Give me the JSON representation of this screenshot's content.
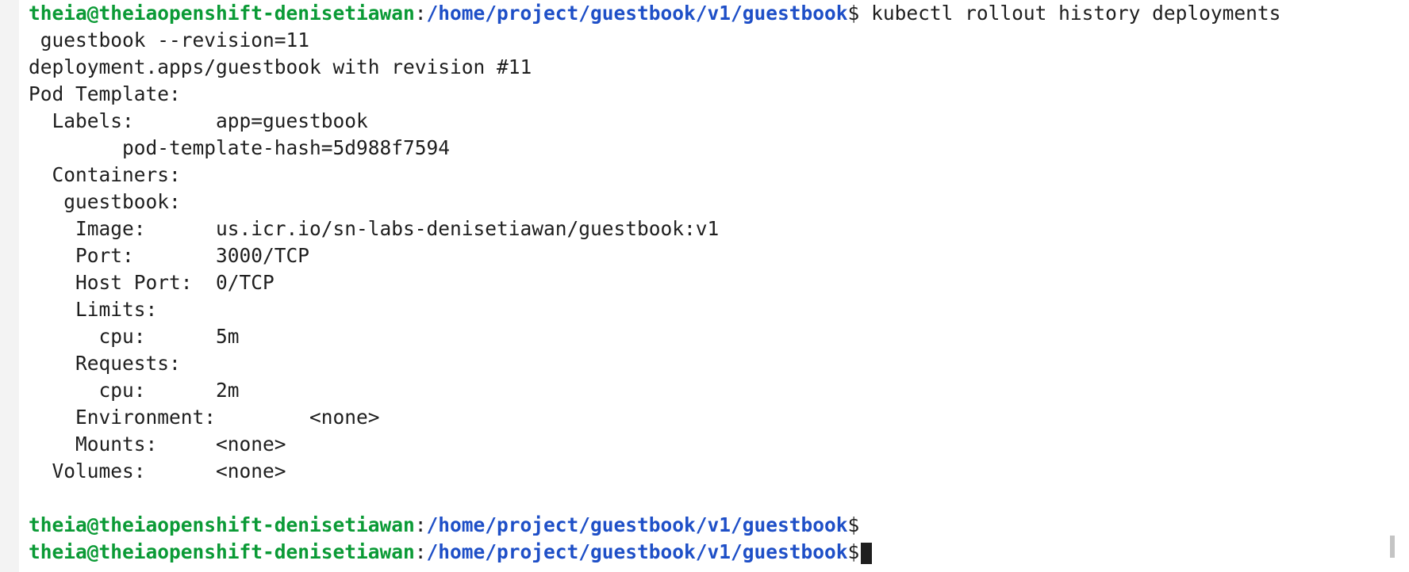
{
  "prompt": {
    "user_host": "theia@theiaopenshift-denisetiawan",
    "colon": ":",
    "path": "/home/project/guestbook/v1/guestbook",
    "dollar": "$"
  },
  "command": " kubectl rollout history deployments",
  "command_cont": " guestbook --revision=11",
  "output": [
    "deployment.apps/guestbook with revision #11",
    "Pod Template:",
    "  Labels:       app=guestbook",
    "        pod-template-hash=5d988f7594",
    "  Containers:",
    "   guestbook:",
    "    Image:      us.icr.io/sn-labs-denisetiawan/guestbook:v1",
    "    Port:       3000/TCP",
    "    Host Port:  0/TCP",
    "    Limits:",
    "      cpu:      5m",
    "    Requests:",
    "      cpu:      2m",
    "    Environment:        <none>",
    "    Mounts:     <none>",
    "  Volumes:      <none>",
    ""
  ],
  "colors": {
    "prompt_user": "#0a9a35",
    "prompt_path": "#1e4fc7",
    "text": "#1e1e1e",
    "background": "#ffffff"
  }
}
